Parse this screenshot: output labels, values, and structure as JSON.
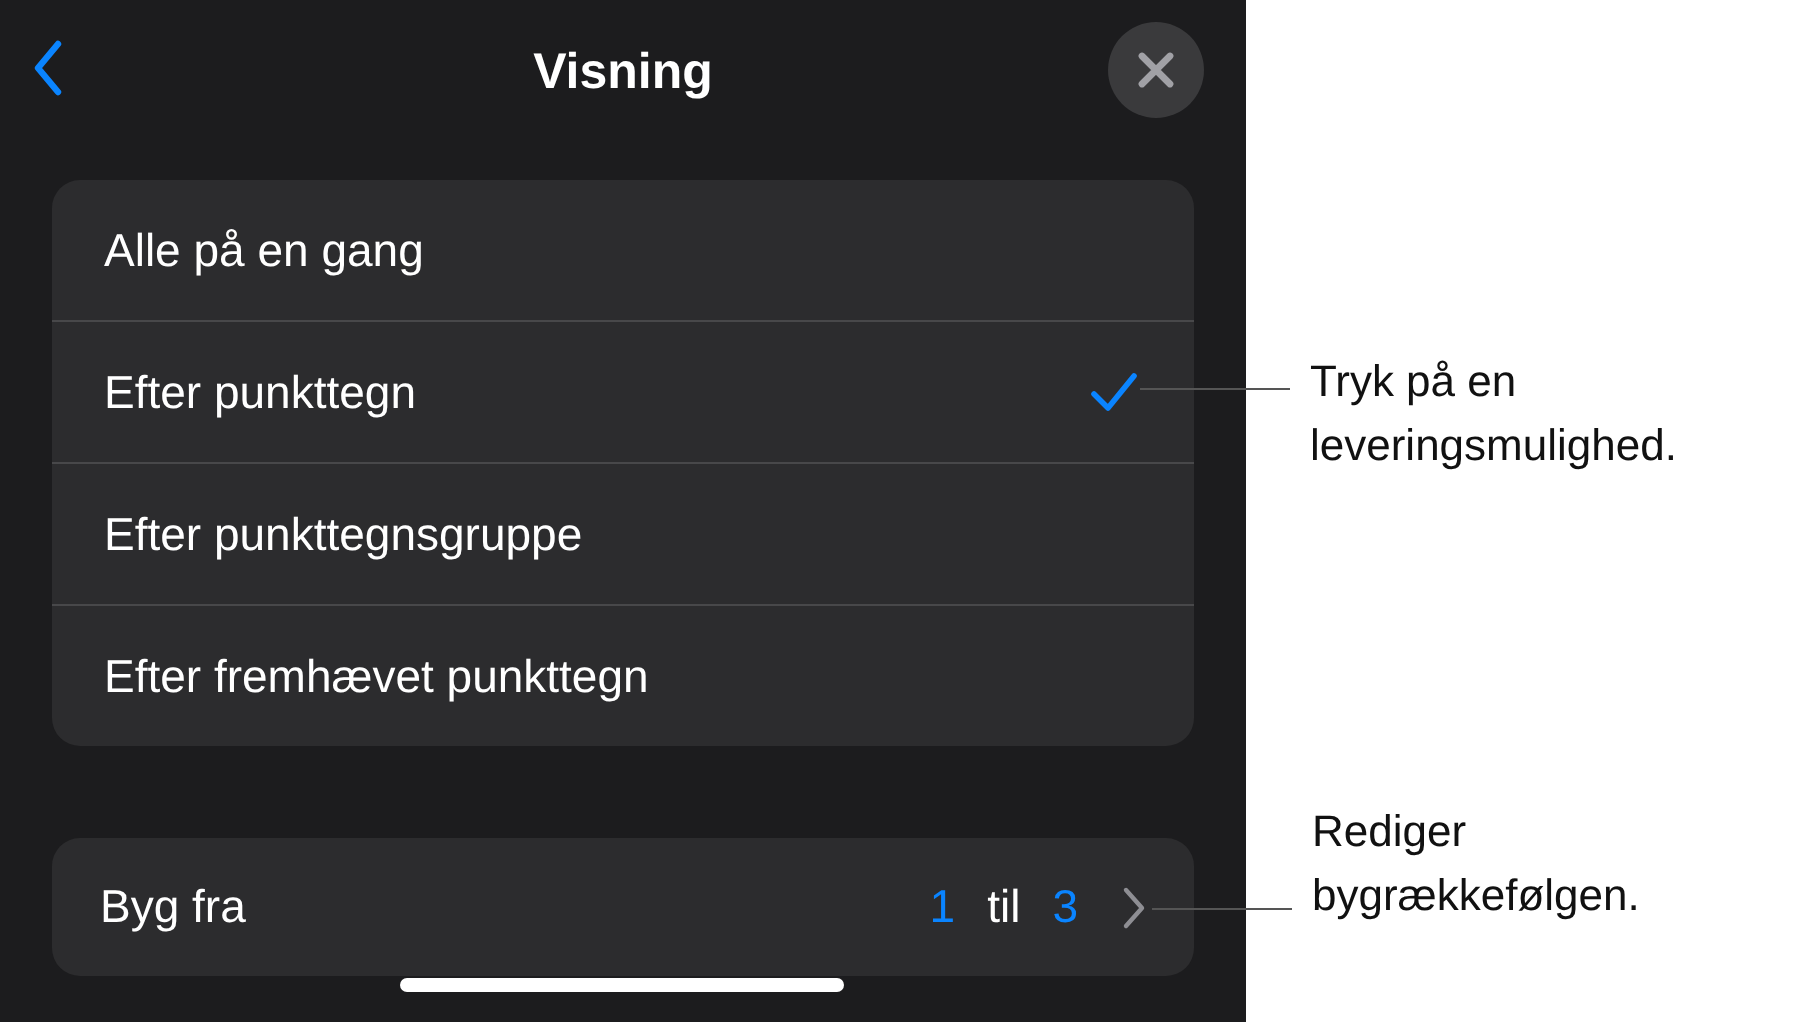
{
  "header": {
    "title": "Visning"
  },
  "options": [
    {
      "label": "Alle på en gang",
      "selected": false
    },
    {
      "label": "Efter punkttegn",
      "selected": true
    },
    {
      "label": "Efter punkttegnsgruppe",
      "selected": false
    },
    {
      "label": "Efter fremhævet punkttegn",
      "selected": false
    }
  ],
  "build_from": {
    "label": "Byg fra",
    "from": "1",
    "to_word": "til",
    "to": "3"
  },
  "callouts": [
    {
      "kind": "option",
      "text": "Tryk på en leveringsmulighed."
    },
    {
      "kind": "build",
      "text": "Rediger bygrækkefølgen."
    }
  ]
}
